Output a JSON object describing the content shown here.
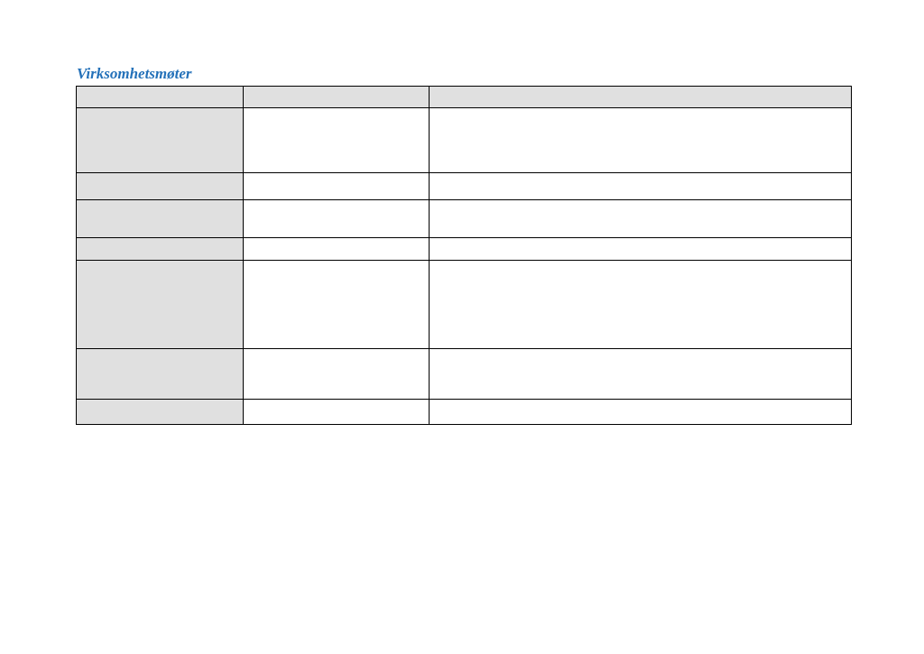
{
  "section": {
    "title": "Virksomhetsmøter"
  },
  "table": {
    "header": {
      "c1": "",
      "c2": "",
      "c3": ""
    },
    "rows": [
      {
        "c1": "",
        "c2": "",
        "c3": ""
      },
      {
        "c1": "",
        "c2": "",
        "c3": ""
      },
      {
        "c1": "",
        "c2": "",
        "c3": ""
      },
      {
        "c1": "",
        "c2": "",
        "c3": ""
      },
      {
        "c1": "",
        "c2": "",
        "c3": ""
      },
      {
        "c1": "",
        "c2": "",
        "c3": ""
      },
      {
        "c1": "",
        "c2": "",
        "c3": ""
      }
    ]
  }
}
